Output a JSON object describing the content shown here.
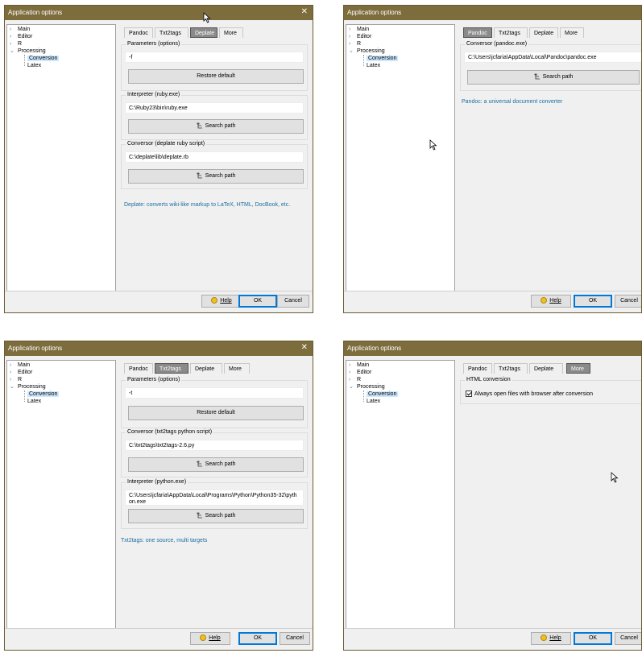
{
  "colors": {
    "titlebar": "#7d6c3c",
    "active_tab": "#8a8a8a",
    "description_text": "#1a6fa3",
    "tree_selection": "#cce8ff",
    "ok_focus": "#0078d7"
  },
  "window_title": "Application options",
  "close_glyph": "✕",
  "tree": {
    "main": "Main",
    "editor": "Editor",
    "r": "R",
    "processing": "Processing",
    "conversion": "Conversion",
    "latex": "Latex"
  },
  "tabs": {
    "pandoc": "Pandoc",
    "txt2tags": "Txt2tags",
    "deplate": "Deplate",
    "more": "More"
  },
  "buttons": {
    "help": "Help",
    "ok": "OK",
    "cancel": "Cancel",
    "restore_default": "Restore default",
    "search_path": "Search path"
  },
  "panels": {
    "deplate": {
      "active_tab": "Deplate",
      "params_title": "Parameters (options)",
      "params_value": "-f",
      "interpreter_title": "Interpreter (ruby.exe)",
      "interpreter_value": "C:\\Ruby23\\bin\\ruby.exe",
      "conversor_title": "Conversor (deplate ruby script)",
      "conversor_value": "C:\\deplate\\lib\\deplate.rb",
      "description": "Deplate: converts wiki-like markup to LaTeX, HTML, DocBook, etc."
    },
    "pandoc": {
      "active_tab": "Pandoc",
      "conversor_title": "Conversor (pandoc.exe)",
      "conversor_value": "C:\\Users\\jcfaria\\AppData\\Local\\Pandoc\\pandoc.exe",
      "description": "Pandoc: a universal document converter"
    },
    "txt2tags": {
      "active_tab": "Txt2tags",
      "params_title": "Parameters (options)",
      "params_value": "-t",
      "conversor_title": "Conversor (txt2tags python script)",
      "conversor_value": "C:\\txt2tags\\txt2tags-2.6.py",
      "interpreter_title": "Interpreter (python.exe)",
      "interpreter_value": "C:\\Users\\jcfaria\\AppData\\Local\\Programs\\Python\\Python35-32\\python.exe",
      "description": "Txt2tags: one source, multi targets"
    },
    "more": {
      "active_tab": "More",
      "html_title": "HTML conversion",
      "checkbox_label": "Always open files with browser after conversion",
      "checkbox_checked": true
    }
  }
}
